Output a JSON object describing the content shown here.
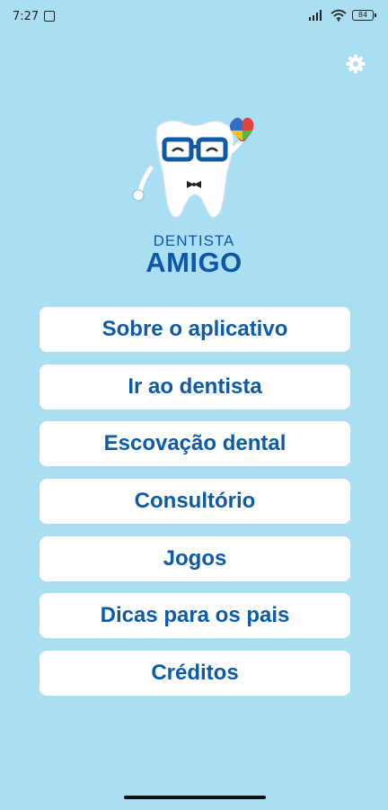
{
  "status_bar": {
    "time": "7:27",
    "battery": "84"
  },
  "logo": {
    "line1": "DENTISTA",
    "line2": "AMIGO"
  },
  "menu": {
    "items": [
      {
        "label": "Sobre o aplicativo"
      },
      {
        "label": "Ir ao dentista"
      },
      {
        "label": "Escovação dental"
      },
      {
        "label": "Consultório"
      },
      {
        "label": "Jogos"
      },
      {
        "label": "Dicas para os pais"
      },
      {
        "label": "Créditos"
      }
    ]
  },
  "icons": {
    "settings": "gear-icon",
    "mascot": "tooth-mascot-icon"
  },
  "colors": {
    "background": "#a9def3",
    "primary_text": "#0d5aa7",
    "button_bg": "#ffffff"
  }
}
